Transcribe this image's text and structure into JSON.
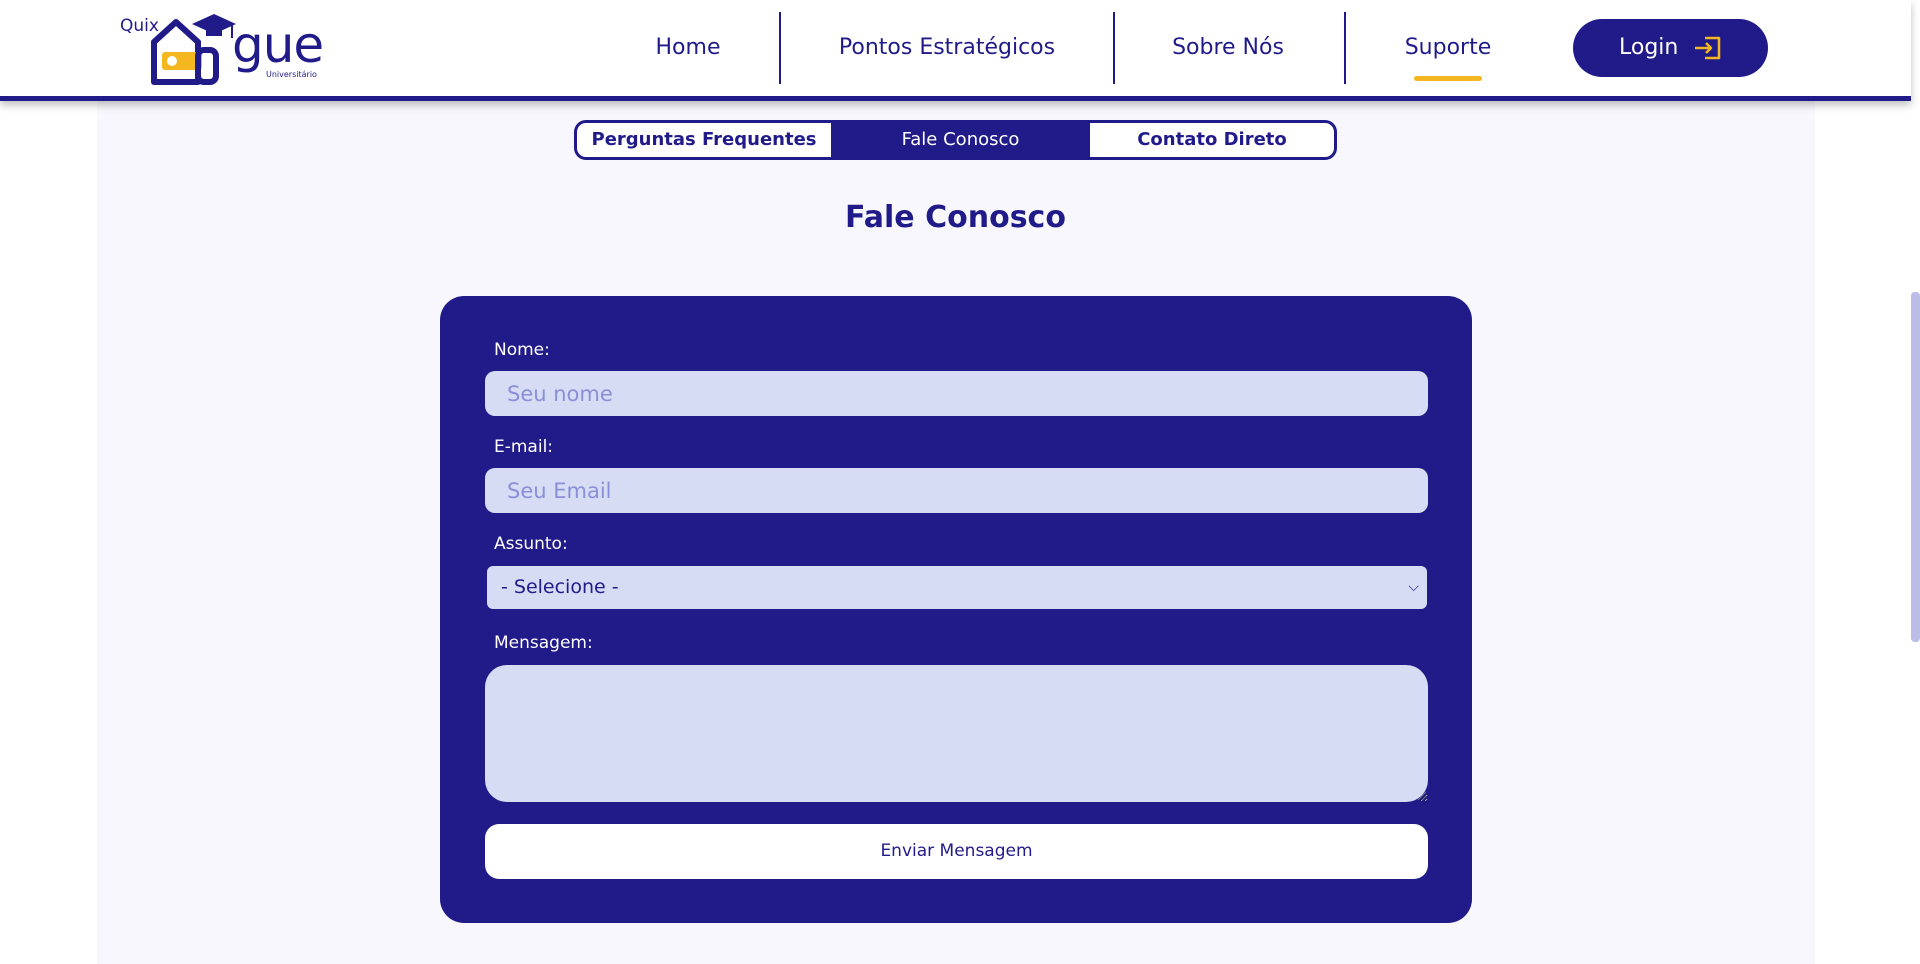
{
  "brand": {
    "prefix": "Quix",
    "name": "gue",
    "tagline": "Universitário",
    "colors": {
      "primary": "#211b8a",
      "accent": "#f5b71f",
      "field": "#d5dcf4"
    }
  },
  "nav": {
    "items": [
      {
        "label": "Home"
      },
      {
        "label": "Pontos Estratégicos"
      },
      {
        "label": "Sobre Nós"
      },
      {
        "label": "Suporte",
        "active": true
      }
    ],
    "login_label": "Login",
    "login_icon": "sign-in-icon"
  },
  "tabs": [
    {
      "label": "Perguntas Frequentes"
    },
    {
      "label": "Fale Conosco",
      "active": true
    },
    {
      "label": "Contato Direto"
    }
  ],
  "page_title": "Fale Conosco",
  "form": {
    "name_label": "Nome:",
    "name_placeholder": "Seu nome",
    "email_label": "E-mail:",
    "email_placeholder": "Seu Email",
    "subject_label": "Assunto:",
    "subject_selected": "- Selecione -",
    "message_label": "Mensagem:",
    "submit_label": "Enviar Mensagem"
  }
}
